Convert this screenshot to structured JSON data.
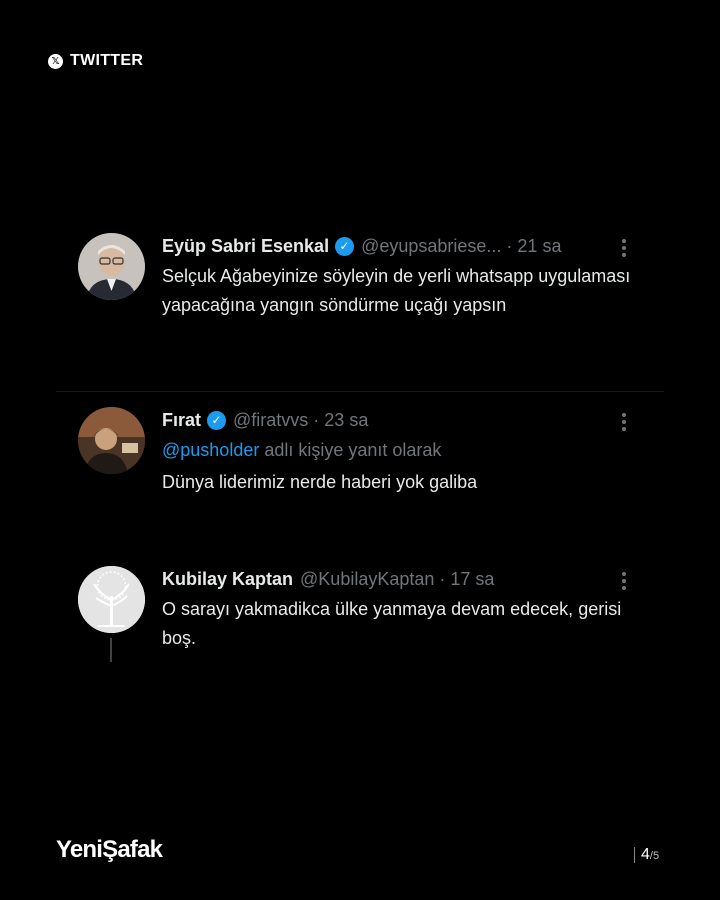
{
  "header": {
    "icon": "x-logo-icon",
    "label": "TWITTER"
  },
  "tweets": [
    {
      "name": "Eyüp Sabri Esenkal",
      "verified": true,
      "handle": "@eyupsabriese...",
      "separator": "·",
      "time": "21 sa",
      "text": "Selçuk Ağabeyinize söyleyin de yerli whatsapp uygulaması yapacağına yangın söndürme uçağı yapsın"
    },
    {
      "name": "Fırat",
      "verified": true,
      "handle": "@firatvvs",
      "separator": "·",
      "time": "23 sa",
      "reply_mention": "@pusholder",
      "reply_suffix": " adlı kişiye yanıt olarak",
      "text": "Dünya liderimiz nerde haberi yok galiba"
    },
    {
      "name": "Kubilay Kaptan",
      "verified": false,
      "handle": "@KubilayKaptan",
      "separator": "·",
      "time": "17 sa",
      "text": "O sarayı yakmadikca ülke yanmaya devam edecek, gerisi boş."
    }
  ],
  "footer": {
    "logo": "YeniŞafak",
    "page_current": "4",
    "page_total": "/5"
  },
  "colors": {
    "background": "#000000",
    "text": "#e7e9ea",
    "muted": "#71767b",
    "accent": "#1d9bf0"
  }
}
